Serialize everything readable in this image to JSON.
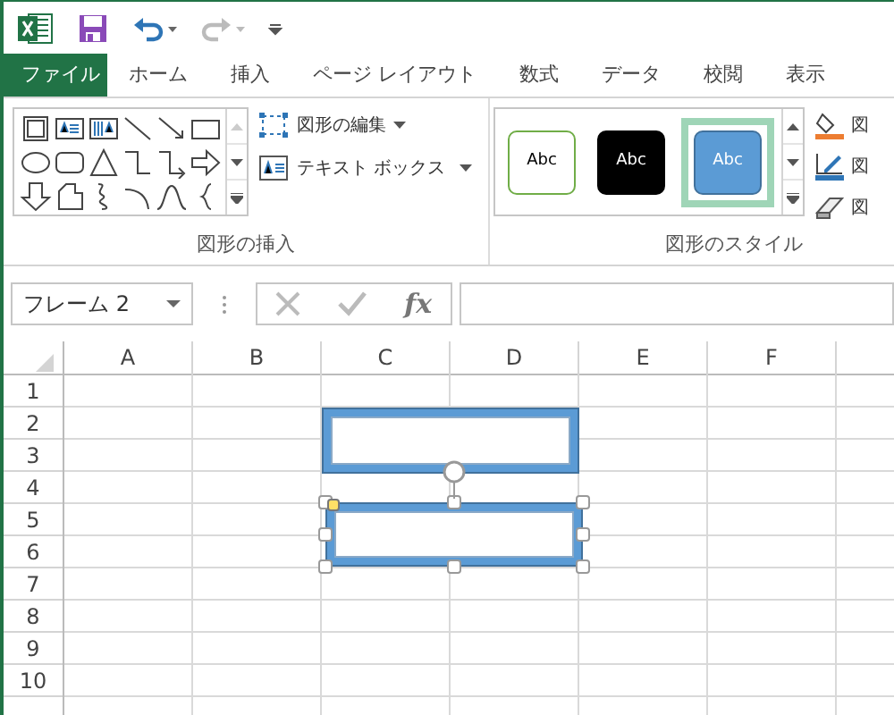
{
  "tabs": [
    {
      "label": "ファイル",
      "kind": "file"
    },
    {
      "label": "ホーム",
      "kind": "tab"
    },
    {
      "label": "挿入",
      "kind": "tab"
    },
    {
      "label": "ページ レイアウト",
      "kind": "tab"
    },
    {
      "label": "数式",
      "kind": "tab"
    },
    {
      "label": "データ",
      "kind": "tab"
    },
    {
      "label": "校閲",
      "kind": "tab"
    },
    {
      "label": "表示",
      "kind": "tab"
    }
  ],
  "insert_shapes": {
    "label": "図形の挿入",
    "buttons": [
      {
        "label": "図形の編集",
        "kind": "edit"
      },
      {
        "label": "テキスト ボックス",
        "kind": "textbox"
      }
    ]
  },
  "shape_styles": {
    "label": "図形のスタイル",
    "styles": [
      {
        "text": "Abc",
        "kind": "outline",
        "selected": false
      },
      {
        "text": "Abc",
        "kind": "dark",
        "selected": false
      },
      {
        "text": "Abc",
        "kind": "blue",
        "selected": true
      }
    ],
    "buttons": [
      {
        "label": "図",
        "kind": "fill"
      },
      {
        "label": "図",
        "kind": "outline"
      },
      {
        "label": "図",
        "kind": "effects"
      }
    ]
  },
  "name_box": {
    "value": "フレーム 2"
  },
  "formula_bar": {
    "fx": "fx"
  },
  "columns": [
    "A",
    "B",
    "C",
    "D",
    "E",
    "F"
  ],
  "rows": [
    "1",
    "2",
    "3",
    "4",
    "5",
    "6",
    "7",
    "8",
    "9",
    "10"
  ],
  "shapes": [
    {
      "selected": false
    },
    {
      "selected": true
    }
  ]
}
